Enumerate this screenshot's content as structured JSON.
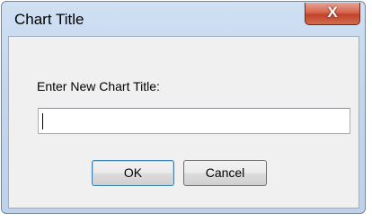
{
  "dialog": {
    "title": "Chart Title",
    "close_symbol": "X",
    "prompt": "Enter New Chart Title:",
    "input": {
      "value": "",
      "placeholder": ""
    },
    "buttons": {
      "ok_label": "OK",
      "cancel_label": "Cancel"
    }
  },
  "icons": {
    "close": "close-icon"
  },
  "colors": {
    "titlebar": "#c3d6ec",
    "close_button": "#c2432a",
    "client_background": "#f0f0f0",
    "default_button_border": "#3c7fb1"
  }
}
